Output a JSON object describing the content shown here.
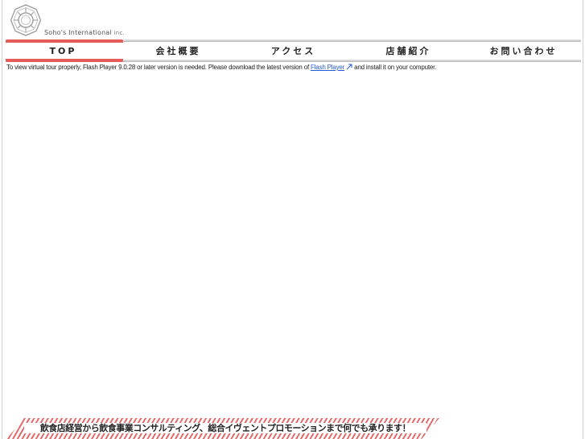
{
  "brand": {
    "name": "Soho's International",
    "suffix": "inc.",
    "accent_color": "#e65a5a"
  },
  "nav": {
    "items": [
      {
        "label": "TOP",
        "active": true
      },
      {
        "label": "会社概要",
        "active": false
      },
      {
        "label": "アクセス",
        "active": false
      },
      {
        "label": "店舗紹介",
        "active": false
      },
      {
        "label": "お問い合わせ",
        "active": false
      }
    ]
  },
  "notice": {
    "before": "To view virtual tour properly, Flash Player 9.0.28 or later version is needed. Please download the latest version of",
    "link": "Flash Player",
    "after": "and install it on your computer."
  },
  "footer": {
    "tagline": "飲食店経営から飲食事業コンサルティング、総合イヴェントプロモーションまで何でも承ります！"
  }
}
